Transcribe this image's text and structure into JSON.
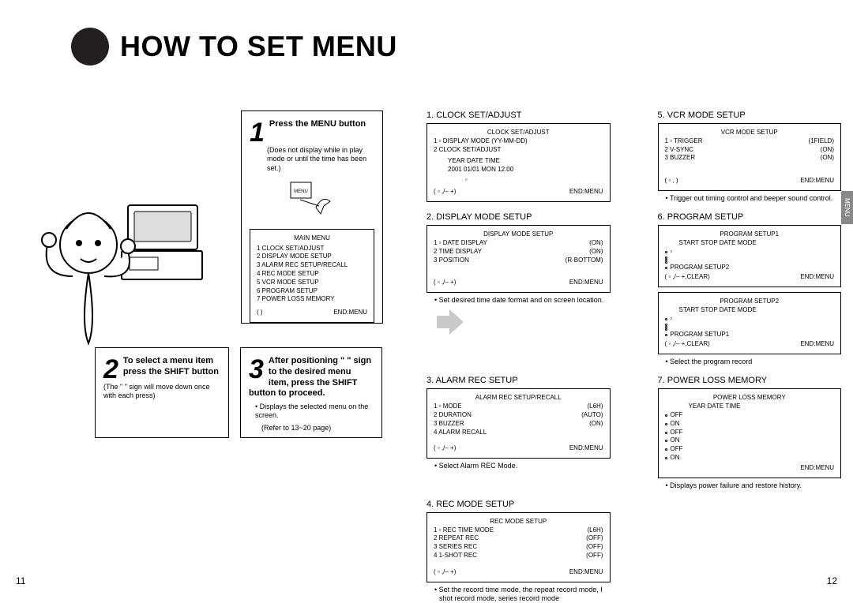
{
  "title": "HOW TO SET MENU",
  "side_tab": "MENU",
  "page_left": "11",
  "page_right": "12",
  "steps": {
    "s1": {
      "num": "1",
      "head": "Press the MENU button",
      "sub": "(Does not display while in play mode or until the time has been set.)",
      "menu_label": "MENU",
      "screen_title": "MAIN MENU",
      "items": [
        "1   CLOCK SET/ADJUST",
        "2   DISPLAY MODE SETUP",
        "3   ALARM REC SETUP/RECALL",
        "4   REC MODE SETUP",
        "5   VCR MODE SETUP",
        "6   PROGRAM SETUP",
        "7   POWER LOSS MEMORY"
      ],
      "end": "END:MENU",
      "left_hint": "(    )"
    },
    "s2": {
      "num": "2",
      "head": "To select a menu item press the SHIFT      button",
      "sub": "(The \"   \" sign will move down once with each press)"
    },
    "s3": {
      "num": "3",
      "head": "After positioning \"    \" sign to the desired menu item, press the SHIFT     button to proceed.",
      "b1": "Displays the selected menu on the screen.",
      "b2": "(Refer to 13~20 page)"
    }
  },
  "sections": {
    "clock": {
      "title": "1. CLOCK SET/ADJUST",
      "scr_title": "CLOCK SET/ADJUST",
      "l1": "1 ▫ DISPLAY MODE (YY-MM-DD)",
      "l2": "2   CLOCK SET/ADJUST",
      "l3": "YEAR     DATE       TIME",
      "l4": "2001      01/01 MON 12:00",
      "end_l": "( ▫ ,/– +)",
      "end_r": "END:MENU"
    },
    "display": {
      "title": "2. DISPLAY MODE SETUP",
      "scr_title": "DISPLAY MODE SETUP",
      "r1l": "1 ▫ DATE DISPLAY",
      "r1r": "(ON)",
      "r2l": "2   TIME DISPLAY",
      "r2r": "(ON)",
      "r3l": "3   POSITION",
      "r3r": "(R-BOTTOM)",
      "end_l": "( ▫ ,/– +)",
      "end_r": "END:MENU",
      "note": "Set desired time date format and on screen location."
    },
    "alarm": {
      "title": "3. ALARM REC SETUP",
      "scr_title": "ALARM REC SETUP/RECALL",
      "r1l": "1 ▫ MODE",
      "r1r": "(L6H)",
      "r2l": "2   DURATION",
      "r2r": "(AUTO)",
      "r3l": "3   BUZZER",
      "r3r": "(ON)",
      "r4l": "4   ALARM RECALL",
      "r4r": "",
      "end_l": "( ▫ ,/– +)",
      "end_r": "END:MENU",
      "note": "Select Alarm REC Mode."
    },
    "rec": {
      "title": "4. REC MODE SETUP",
      "scr_title": "REC MODE SETUP",
      "r1l": "1 ▫ REC TIME MODE",
      "r1r": "(L6H)",
      "r2l": "2   REPEAT REC",
      "r2r": "(OFF)",
      "r3l": "3   SERIES REC",
      "r3r": "(OFF)",
      "r4l": "4   1-SHOT REC",
      "r4r": "(OFF)",
      "end_l": "( ▫ ,/– +)",
      "end_r": "END:MENU",
      "note": "Set the record time mode, the repeat record mode, I shot record mode, series record mode"
    },
    "vcr": {
      "title": "5. VCR MODE SETUP",
      "scr_title": "VCR MODE SETUP",
      "r1l": "1 ▫ TRIGGER",
      "r1r": "(1FIELD)",
      "r2l": "2   V-SYNC",
      "r2r": "(ON)",
      "r3l": "3   BUZZER",
      "r3r": "(ON)",
      "end_l": "( ▫ ,   )",
      "end_r": "END:MENU",
      "note": "Trigger out timing control and beeper sound control."
    },
    "program": {
      "title": "6. PROGRAM SETUP",
      "scr_title1": "PROGRAM SETUP1",
      "hdr1": "START  STOP  DATE    MODE",
      "link1": "PROGRAM SETUP2",
      "end_l1": "( ▫ ,/– +,CLEAR)",
      "end_r1": "END:MENU",
      "scr_title2": "PROGRAM SETUP2",
      "hdr2": "START  STOP  DATE    MODE",
      "link2": "PROGRAM SETUP1",
      "end_l2": "( ▫ ,/– +,CLEAR)",
      "end_r2": "END:MENU",
      "note": "Select the program record"
    },
    "power": {
      "title": "7. POWER LOSS MEMORY",
      "scr_title": "POWER LOSS MEMORY",
      "hdr": "YEAR  DATE  TIME",
      "rows": [
        "OFF",
        "ON",
        "OFF",
        "ON",
        "OFF",
        "ON"
      ],
      "end_l": "",
      "end_r": "END:MENU",
      "note": "Displays power failure and restore history."
    }
  }
}
